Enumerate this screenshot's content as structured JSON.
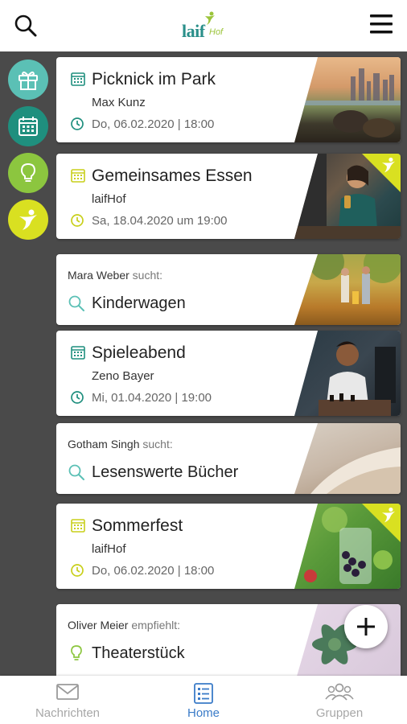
{
  "app": {
    "logo_text": "laif",
    "logo_sub": "Hof"
  },
  "colors": {
    "teal": "#1f8f7e",
    "teal_light": "#5bc0b5",
    "green": "#8cc63f",
    "yellow": "#d9e021",
    "active_blue": "#3a7bc8"
  },
  "rail": [
    {
      "icon": "gift-icon"
    },
    {
      "icon": "calendar-icon"
    },
    {
      "icon": "lightbulb-icon"
    },
    {
      "icon": "laif-figure-icon"
    }
  ],
  "cards": [
    {
      "kind": "event",
      "title": "Picknick im Park",
      "organizer": "Max Kunz",
      "date": "Do, 06.02.2020 | 18:00",
      "accent": "#1f8f7e",
      "badge": false
    },
    {
      "kind": "event",
      "title": "Gemeinsames Essen",
      "organizer": "laifHof",
      "date": "Sa, 18.04.2020 um 19:00",
      "accent": "#d9e021",
      "badge": true
    },
    {
      "kind": "request",
      "person": "Mara Weber",
      "verb": "sucht:",
      "title": "Kinderwagen"
    },
    {
      "kind": "event",
      "title": "Spieleabend",
      "organizer": "Zeno Bayer",
      "date": "Mi, 01.04.2020 | 19:00",
      "accent": "#1f8f7e",
      "badge": false
    },
    {
      "kind": "request",
      "person": "Gotham Singh",
      "verb": "sucht:",
      "title": "Lesenswerte Bücher"
    },
    {
      "kind": "event",
      "title": "Sommerfest",
      "organizer": "laifHof",
      "date": "Do, 06.02.2020 | 18:00",
      "accent": "#d9e021",
      "badge": true
    },
    {
      "kind": "recommend",
      "person": "Oliver Meier",
      "verb": "empfiehlt:",
      "title": "Theaterstück"
    }
  ],
  "bottom_nav": [
    {
      "label": "Nachrichten",
      "icon": "envelope-icon",
      "active": false
    },
    {
      "label": "Home",
      "icon": "list-icon",
      "active": true
    },
    {
      "label": "Gruppen",
      "icon": "group-icon",
      "active": false
    }
  ]
}
